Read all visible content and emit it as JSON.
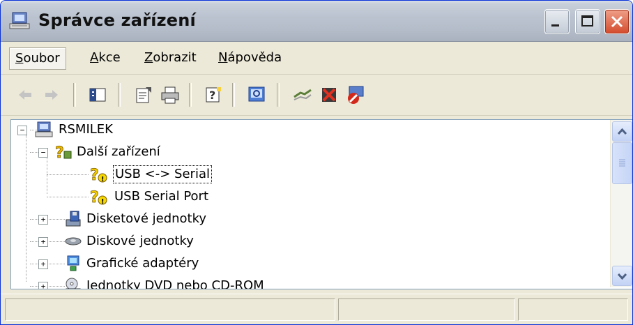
{
  "window": {
    "title": "Správce zařízení",
    "buttons": [
      "minimize",
      "maximize",
      "close"
    ]
  },
  "menubar": {
    "items": [
      {
        "label": "Soubor",
        "mnemonic": "S"
      },
      {
        "label": "Akce",
        "mnemonic": "A"
      },
      {
        "label": "Zobrazit",
        "mnemonic": "Z"
      },
      {
        "label": "Nápověda",
        "mnemonic": "N"
      }
    ]
  },
  "toolbar": {
    "buttons": [
      "back-arrow-icon",
      "forward-arrow-icon",
      "console-tree-icon",
      "properties-icon",
      "print-icon",
      "help-icon",
      "scan-hardware-icon",
      "update-driver-icon",
      "uninstall-icon",
      "disable-icon"
    ]
  },
  "tree": {
    "root": {
      "label": "RSMILEK",
      "expanded": true
    },
    "nodes": [
      {
        "label": "Další zařízení",
        "expanded": true
      },
      {
        "label": "USB <-> Serial",
        "selected": true
      },
      {
        "label": "USB Serial Port"
      },
      {
        "label": "Disketové jednotky",
        "expanded": false
      },
      {
        "label": "Diskové jednotky",
        "expanded": false
      },
      {
        "label": "Grafické adaptéry",
        "expanded": false
      },
      {
        "label": "Jednotky DVD nebo CD-ROM",
        "expanded": false
      }
    ]
  },
  "statusbar": {
    "panes": [
      "",
      "",
      ""
    ]
  }
}
